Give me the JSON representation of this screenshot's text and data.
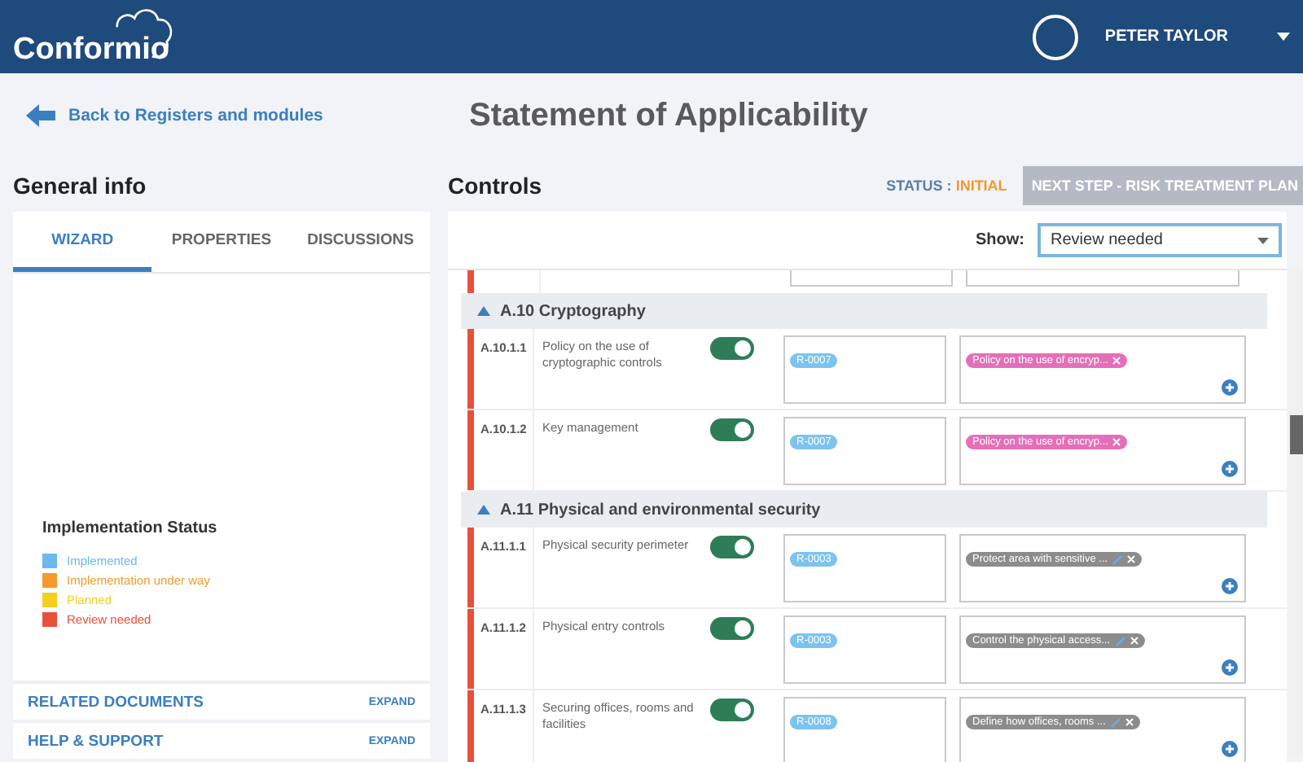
{
  "header": {
    "logo": "Conformio",
    "user": "PETER TAYLOR"
  },
  "back_link": "Back to Registers and modules",
  "page_title": "Statement of Applicability",
  "general_info": {
    "title": "General info",
    "tabs": [
      {
        "label": "WIZARD",
        "selected": true
      },
      {
        "label": "PROPERTIES",
        "selected": false
      },
      {
        "label": "DISCUSSIONS",
        "selected": false
      }
    ],
    "legend_title": "Implementation Status",
    "legend": [
      {
        "label": "Implemented",
        "color": "#6ab8ee"
      },
      {
        "label": "Implementation under way",
        "color": "#f39a2b"
      },
      {
        "label": "Planned",
        "color": "#f5cf1d"
      },
      {
        "label": "Review needed",
        "color": "#e8503a"
      }
    ],
    "sections": [
      {
        "label": "RELATED DOCUMENTS",
        "action": "EXPAND"
      },
      {
        "label": "HELP & SUPPORT",
        "action": "EXPAND"
      }
    ]
  },
  "controls": {
    "title": "Controls",
    "status_label": "STATUS :",
    "status_value": "INITIAL",
    "next_button": {
      "label": "NEXT STEP - RISK TREATMENT PLAN",
      "disabled": true
    },
    "show_label": "Show:",
    "show_value": "Review needed",
    "groups": [
      {
        "title": "A.10 Cryptography",
        "expanded": true,
        "items": [
          {
            "code": "A.10.1.1",
            "name": "Policy on the use of cryptographic controls",
            "color": "#e8503a",
            "on": true,
            "risks": [
              "R-0007"
            ],
            "measures": [
              {
                "label": "Policy on the use of encryp...",
                "kind": "document",
                "color": "#e46fb9"
              }
            ]
          },
          {
            "code": "A.10.1.2",
            "name": "Key management",
            "color": "#e8503a",
            "on": true,
            "risks": [
              "R-0007"
            ],
            "measures": [
              {
                "label": "Policy on the use of encryp...",
                "kind": "document",
                "color": "#e46fb9"
              }
            ]
          }
        ]
      },
      {
        "title": "A.11 Physical and environmental security",
        "expanded": true,
        "items": [
          {
            "code": "A.11.1.1",
            "name": "Physical security perimeter",
            "color": "#e8503a",
            "on": true,
            "risks": [
              "R-0003"
            ],
            "measures": [
              {
                "label": "Protect area with sensitive ...",
                "kind": "task",
                "color": "#8c8c8c"
              }
            ]
          },
          {
            "code": "A.11.1.2",
            "name": "Physical entry controls",
            "color": "#e8503a",
            "on": true,
            "risks": [
              "R-0003"
            ],
            "measures": [
              {
                "label": "Control the physical access...",
                "kind": "task",
                "color": "#8c8c8c"
              }
            ]
          },
          {
            "code": "A.11.1.3",
            "name": "Securing offices, rooms and facilities",
            "color": "#e8503a",
            "on": true,
            "risks": [
              "R-0008"
            ],
            "measures": [
              {
                "label": "Define how offices, rooms ...",
                "kind": "task",
                "color": "#8c8c8c"
              }
            ]
          }
        ]
      }
    ]
  }
}
